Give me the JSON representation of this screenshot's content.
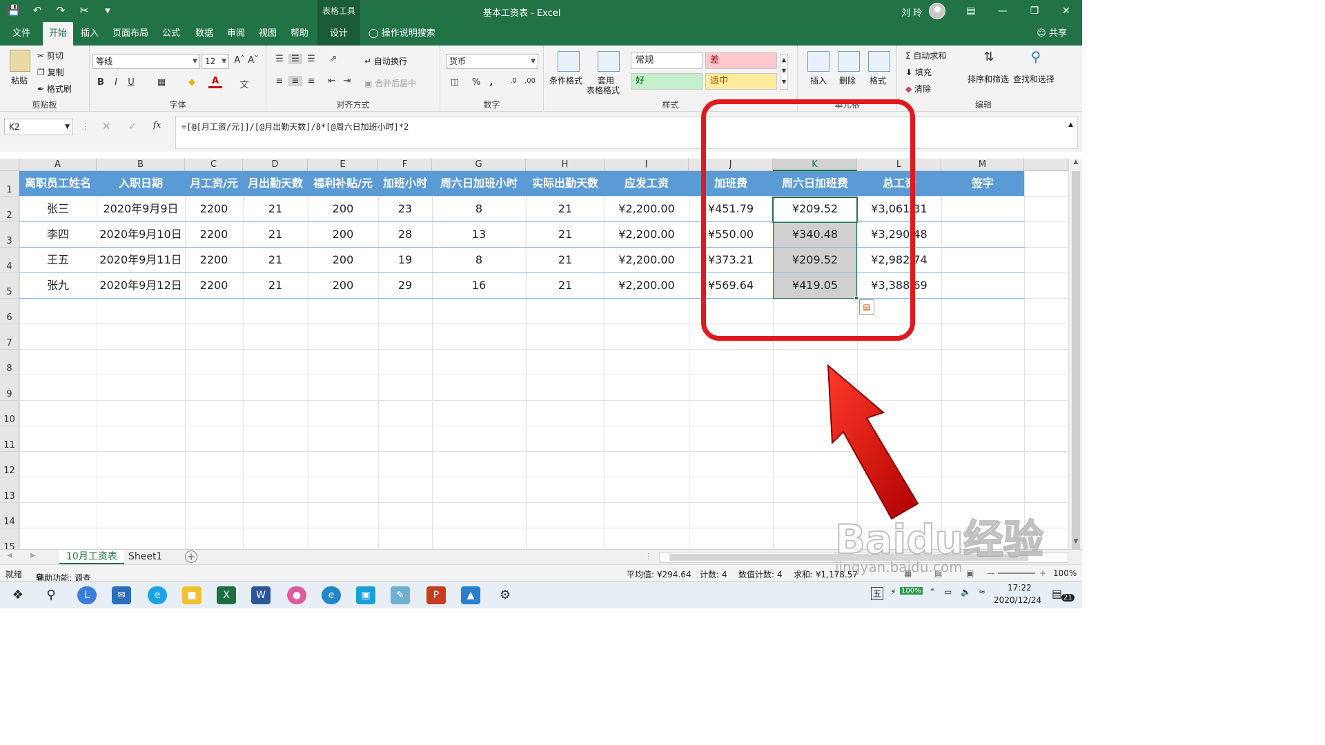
{
  "window": {
    "context_tab_title": "表格工具",
    "doc_title": "基本工资表 - Excel",
    "user_name": "刘 玲"
  },
  "tabs": [
    "文件",
    "开始",
    "插入",
    "页面布局",
    "公式",
    "数据",
    "审阅",
    "视图",
    "帮助",
    "设计"
  ],
  "active_tab": "开始",
  "tell_me": "操作说明搜索",
  "share": "共享",
  "ribbon": {
    "clipboard": {
      "label": "剪贴板",
      "paste": "粘贴",
      "cut": "剪切",
      "copy": "复制",
      "format_painter": "格式刷"
    },
    "font": {
      "label": "字体",
      "font_name": "等线",
      "font_size": "12",
      "bold": "B",
      "italic": "I",
      "underline": "U"
    },
    "alignment": {
      "label": "对齐方式",
      "wrap_text": "自动换行",
      "merge": "合并后居中"
    },
    "number": {
      "label": "数字",
      "format": "货币",
      "percent": "%",
      "comma": ","
    },
    "styles": {
      "label": "样式",
      "conditional": "条件格式",
      "table_format_1": "套用",
      "table_format_2": "表格格式",
      "normal": "常规",
      "bad": "差",
      "good": "好",
      "neutral": "适中"
    },
    "cells": {
      "label": "单元格",
      "insert": "插入",
      "delete": "删除",
      "format": "格式"
    },
    "editing": {
      "label": "编辑",
      "autosum": "自动求和",
      "fill": "填充",
      "clear": "清除",
      "sort_filter": "排序和筛选",
      "find_select": "查找和选择"
    }
  },
  "formula_bar": {
    "name_box": "K2",
    "fx": "fx",
    "formula": "=[@[月工资/元]]/[@月出勤天数]/8*[@周六日加班小时]*2"
  },
  "columns": [
    "A",
    "B",
    "C",
    "D",
    "E",
    "F",
    "G",
    "H",
    "I",
    "J",
    "K",
    "L",
    "M"
  ],
  "selected_column": "K",
  "row_numbers": [
    "1",
    "2",
    "3",
    "4",
    "5",
    "6",
    "7",
    "8",
    "9",
    "10",
    "11",
    "12",
    "13",
    "14",
    "15"
  ],
  "table": {
    "headers": [
      "离职员工姓名",
      "入职日期",
      "月工资/元",
      "月出勤天数",
      "福利补贴/元",
      "加班小时",
      "周六日加班小时",
      "实际出勤天数",
      "应发工资",
      "加班费",
      "周六日加班费",
      "总工资",
      "签字"
    ],
    "rows": [
      [
        "张三",
        "2020年9月9日",
        "2200",
        "21",
        "200",
        "23",
        "8",
        "21",
        "¥2,200.00",
        "¥451.79",
        "¥209.52",
        "¥3,061.31",
        ""
      ],
      [
        "李四",
        "2020年9月10日",
        "2200",
        "21",
        "200",
        "28",
        "13",
        "21",
        "¥2,200.00",
        "¥550.00",
        "¥340.48",
        "¥3,290.48",
        ""
      ],
      [
        "王五",
        "2020年9月11日",
        "2200",
        "21",
        "200",
        "19",
        "8",
        "21",
        "¥2,200.00",
        "¥373.21",
        "¥209.52",
        "¥2,982.74",
        ""
      ],
      [
        "张九",
        "2020年9月12日",
        "2200",
        "21",
        "200",
        "29",
        "16",
        "21",
        "¥2,200.00",
        "¥569.64",
        "¥419.05",
        "¥3,388.69",
        ""
      ]
    ]
  },
  "sheets": [
    "10月工资表",
    "Sheet1"
  ],
  "active_sheet": "10月工资表",
  "status": {
    "ready": "就绪",
    "accessibility": "辅助功能: 调查",
    "average": "平均值: ¥294.64",
    "count": "计数: 4",
    "numeric_count": "数值计数: 4",
    "sum": "求和: ¥1,178.57",
    "zoom": "100%"
  },
  "taskbar": {
    "ime": "五",
    "battery": "100%",
    "time": "17:22",
    "date": "2020/12/24",
    "notifications": "21"
  },
  "watermark": {
    "main": "Baidu经验",
    "sub": "jingyan.baidu.com"
  },
  "colors": {
    "excel_green": "#217346",
    "table_header_blue": "#5b9bd5",
    "annotation_red": "#e0191f",
    "style_bad_bg": "#ffc7ce",
    "style_good_bg": "#c6efce",
    "style_neutral_bg": "#ffeb9c"
  }
}
